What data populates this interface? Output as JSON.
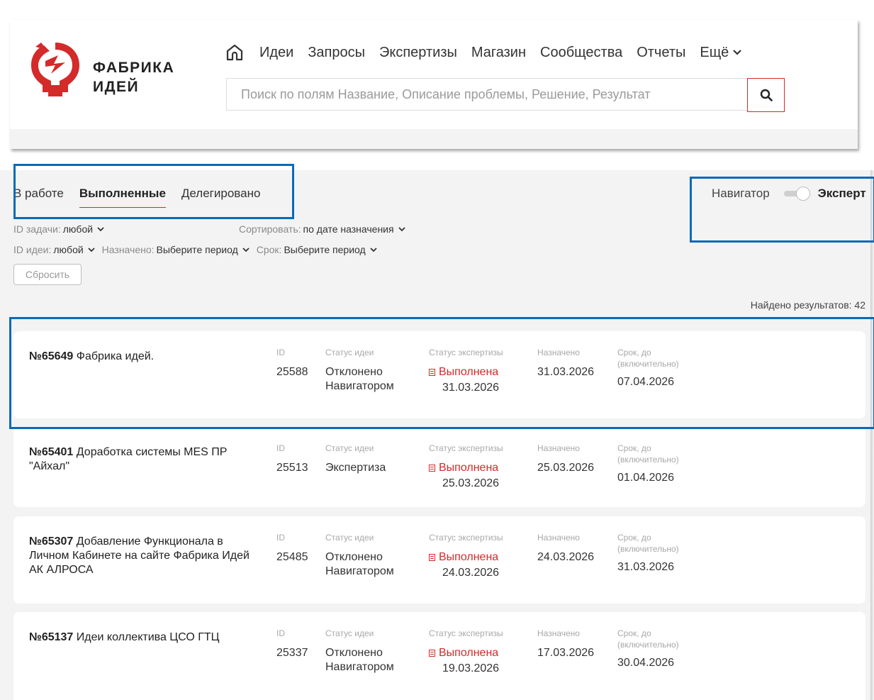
{
  "header": {
    "logo_line1": "ФАБРИКА",
    "logo_line2": "ИДЕЙ",
    "nav_items": [
      "Идеи",
      "Запросы",
      "Экспертизы",
      "Магазин",
      "Сообщества",
      "Отчеты"
    ],
    "nav_more": "Ещё",
    "search_placeholder": "Поиск по полям Название, Описание проблемы, Решение, Результат",
    "icons": {
      "home": "home-icon",
      "search": "search-icon",
      "more": "chevron-down-icon"
    },
    "brand_color": "#d42a2a"
  },
  "tabs": [
    {
      "label": "В работе",
      "active": false
    },
    {
      "label": "Выполненные",
      "active": true
    },
    {
      "label": "Делегировано",
      "active": false
    }
  ],
  "toggle": {
    "left_label": "Навигатор",
    "right_label": "Эксперт",
    "state": "Эксперт"
  },
  "filters": {
    "task_id": {
      "label": "ID задачи:",
      "value": "любой"
    },
    "sort": {
      "label": "Сортировать:",
      "value": "по дате назначения"
    },
    "idea_id": {
      "label": "ID идеи:",
      "value": "любой"
    },
    "assigned": {
      "label": "Назначено:",
      "value": "Выберите период"
    },
    "deadline": {
      "label": "Срок:",
      "value": "Выберите период"
    },
    "reset_label": "Сбросить"
  },
  "results_count": "Найдено результатов: 42",
  "column_labels": {
    "id": "ID",
    "idea_status": "Статус идеи",
    "expertise_status": "Статус экспертизы",
    "assigned": "Назначено",
    "deadline": "Срок, до (включительно)"
  },
  "tasks": [
    {
      "number": "№65649",
      "title": "Фабрика идей.",
      "id": "25588",
      "idea_status_1": "Отклонено",
      "idea_status_2": "Навигатором",
      "expertise_status": "Выполнена",
      "expertise_date": "31.03.2026",
      "assigned": "31.03.2026",
      "deadline": "07.04.2026"
    },
    {
      "number": "№65401",
      "title": "Доработка системы MES ПР \"Айхал\"",
      "id": "25513",
      "idea_status_1": "Экспертиза",
      "idea_status_2": "",
      "expertise_status": "Выполнена",
      "expertise_date": "25.03.2026",
      "assigned": "25.03.2026",
      "deadline": "01.04.2026"
    },
    {
      "number": "№65307",
      "title": "Добавление Функционала в Личном Кабинете на сайте Фабрика Идей АК АЛРОСА",
      "id": "25485",
      "idea_status_1": "Отклонено",
      "idea_status_2": "Навигатором",
      "expertise_status": "Выполнена",
      "expertise_date": "24.03.2026",
      "assigned": "24.03.2026",
      "deadline": "31.03.2026"
    },
    {
      "number": "№65137",
      "title": "Идеи коллектива ЦСО ГТЦ",
      "id": "25337",
      "idea_status_1": "Отклонено",
      "idea_status_2": "Навигатором",
      "expertise_status": "Выполнена",
      "expertise_date": "19.03.2026",
      "assigned": "17.03.2026",
      "deadline": "30.04.2026"
    }
  ],
  "annotation_color": "#0a6ab8"
}
